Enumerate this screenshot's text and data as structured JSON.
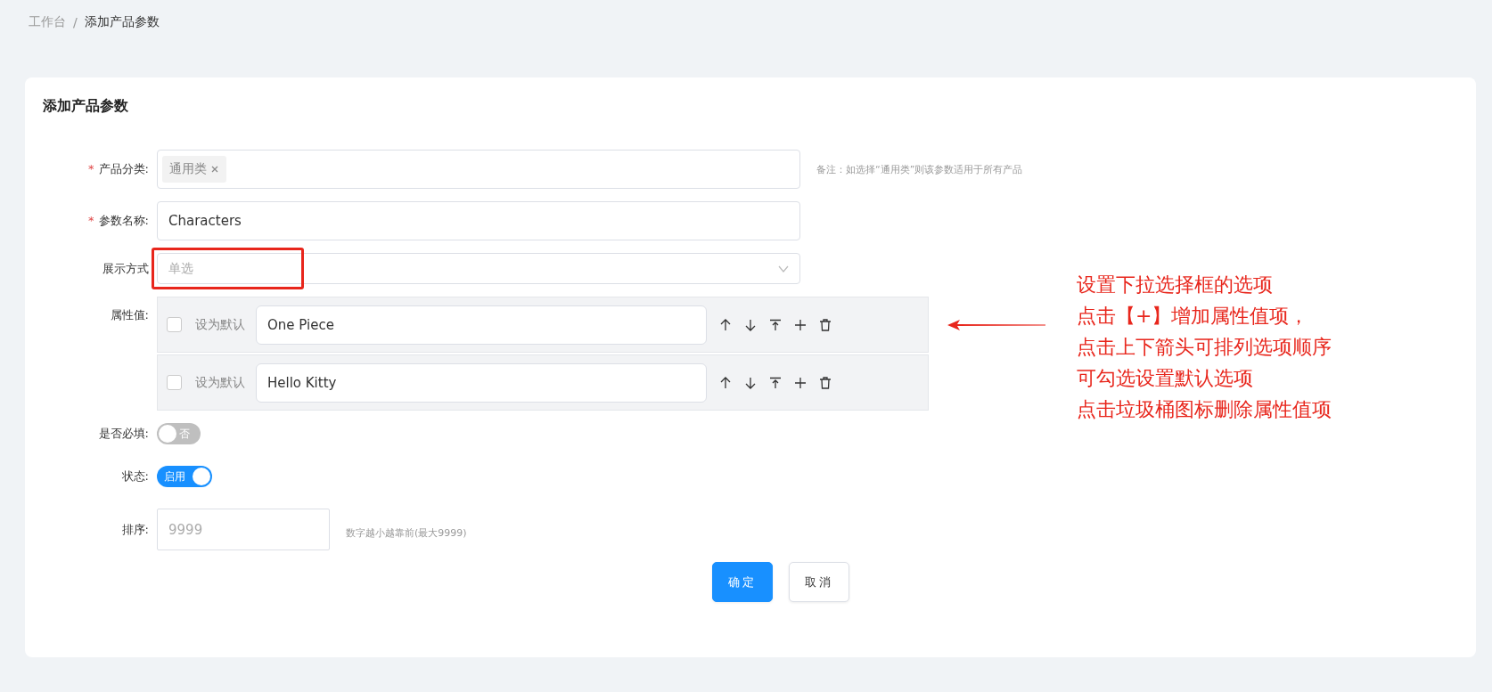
{
  "breadcrumb": [
    {
      "label": "工作台",
      "current": false
    },
    {
      "label": "添加产品参数",
      "current": true
    }
  ],
  "breadcrumb_separator": "/",
  "card": {
    "title": "添加产品参数"
  },
  "form": {
    "category": {
      "label": "产品分类:",
      "required_mark": "*",
      "tags": [
        "通用类"
      ],
      "note": "备注：如选择“通用类”则该参数适用于所有产品"
    },
    "name": {
      "label": "参数名称:",
      "required_mark": "*",
      "value": "Characters"
    },
    "display": {
      "label": "展示方式",
      "placeholder": "单选",
      "highlighted": true
    },
    "values": {
      "label": "属性值:",
      "items": [
        {
          "checked": false,
          "default_label": "设为默认",
          "value": "One Piece"
        },
        {
          "checked": false,
          "default_label": "设为默认",
          "value": "Hello Kitty"
        }
      ]
    },
    "required_switch": {
      "label": "是否必填:",
      "on": false,
      "text": "否"
    },
    "status_switch": {
      "label": "状态:",
      "on": true,
      "text": "启用"
    },
    "sort": {
      "label": "排序:",
      "placeholder": "9999",
      "hint": "数字越小越靠前(最大9999)"
    }
  },
  "buttons": [
    {
      "label": "确定",
      "kind": "primary"
    },
    {
      "label": "取消",
      "kind": "default"
    }
  ],
  "annotation": {
    "lines": [
      "设置下拉选择框的选项",
      "点击【+】增加属性值项，",
      "点击上下箭头可排列选项顺序",
      "可勾选设置默认选项",
      "点击垃圾桶图标删除属性值项"
    ]
  }
}
